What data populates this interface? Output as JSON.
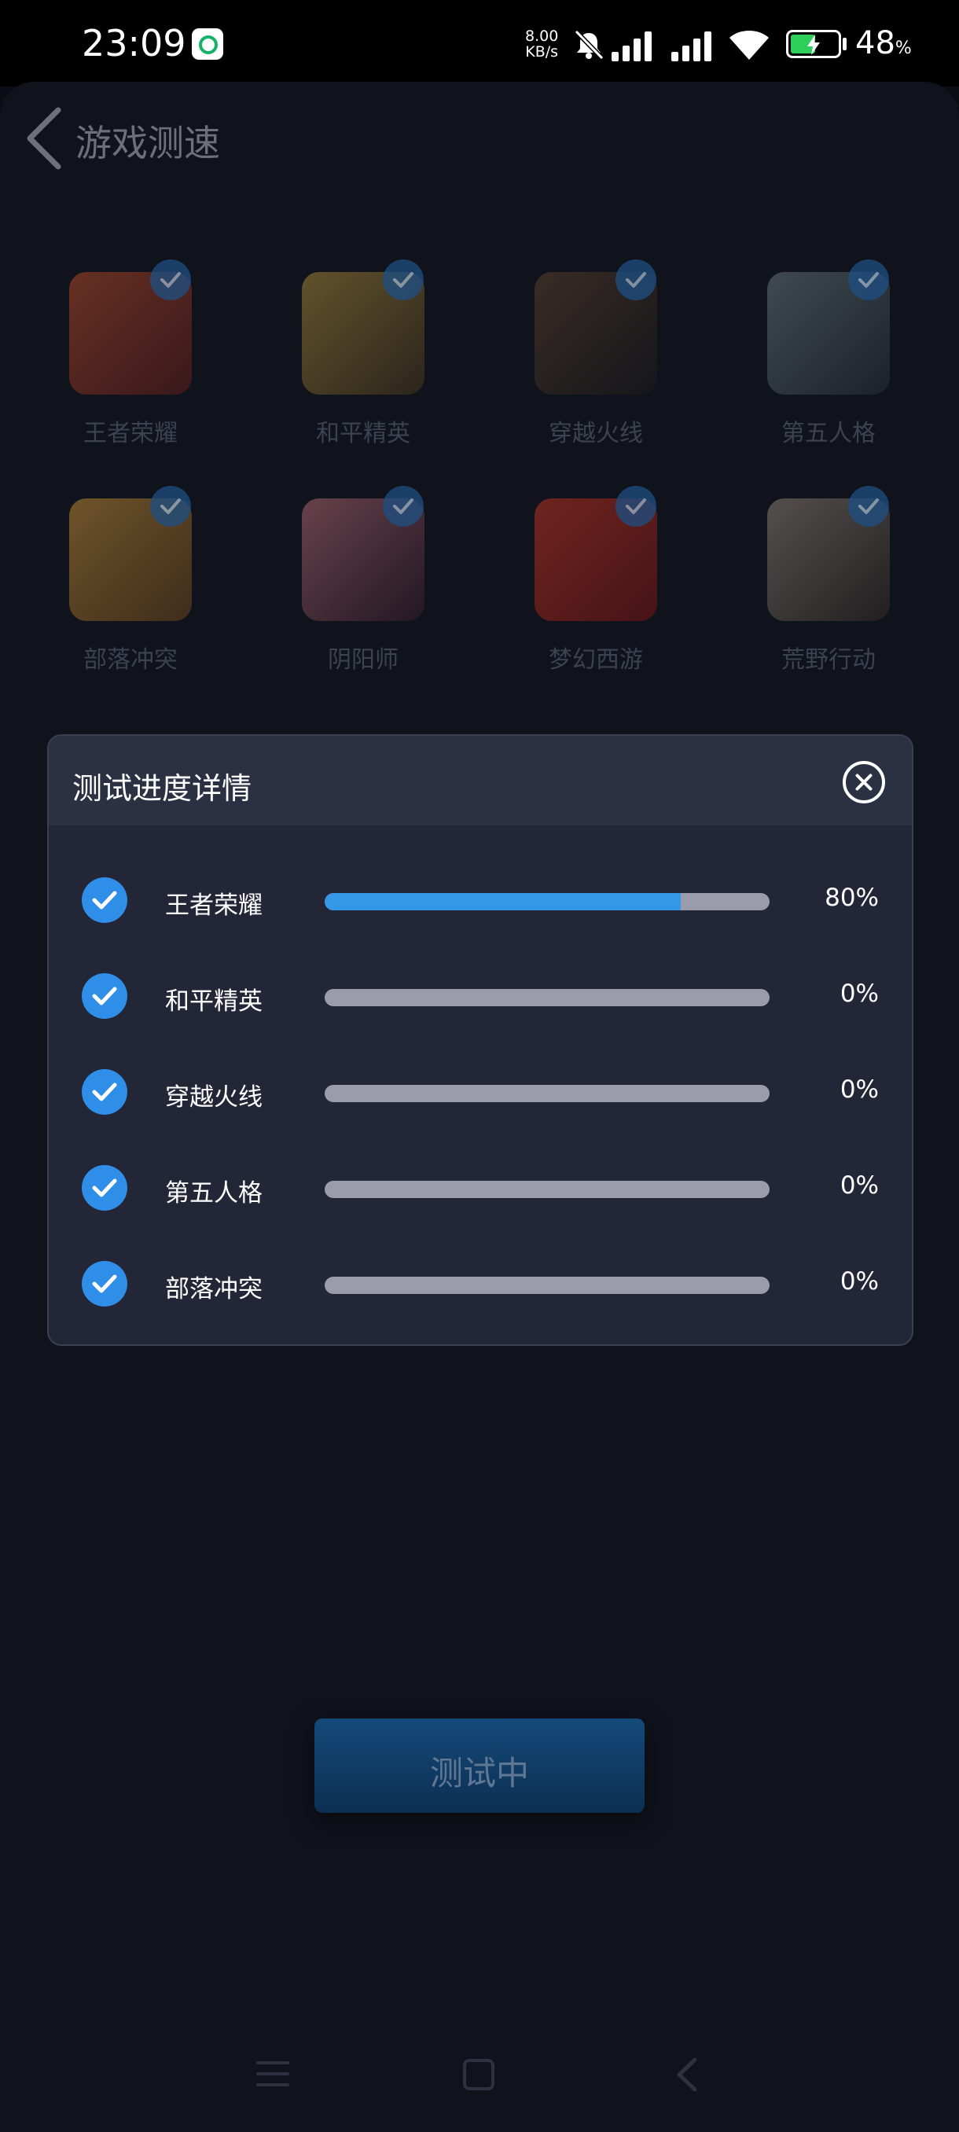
{
  "status_bar": {
    "time": "23:09",
    "net_speed_value": "8.00",
    "net_speed_unit": "KB/s",
    "battery_percent": "48",
    "battery_percent_sign": "%",
    "icons": [
      "app-notification-icon",
      "mute-icon",
      "signal-icon",
      "signal-icon",
      "wifi-icon",
      "battery-icon"
    ]
  },
  "header": {
    "title": "游戏测速",
    "back_icon": "chevron-left-icon"
  },
  "games": [
    {
      "name": "王者荣耀",
      "checked": true,
      "color": "#b8432f"
    },
    {
      "name": "和平精英",
      "checked": true,
      "color": "#9b7a2a"
    },
    {
      "name": "穿越火线",
      "checked": true,
      "color": "#4a3c34"
    },
    {
      "name": "第五人格",
      "checked": true,
      "color": "#5a6a72"
    },
    {
      "name": "部落冲突",
      "checked": true,
      "color": "#b8862a"
    },
    {
      "name": "阴阳师",
      "checked": true,
      "color": "#a0504e"
    },
    {
      "name": "梦幻西游",
      "checked": true,
      "color": "#b02418"
    },
    {
      "name": "荒野行动",
      "checked": true,
      "color": "#7a6e60"
    }
  ],
  "dialog": {
    "title": "测试进度详情",
    "close_icon": "close-circle-icon",
    "rows": [
      {
        "name": "王者荣耀",
        "percent_label": "80%",
        "progress": 0.8
      },
      {
        "name": "和平精英",
        "percent_label": "0%",
        "progress": 0
      },
      {
        "name": "穿越火线",
        "percent_label": "0%",
        "progress": 0
      },
      {
        "name": "第五人格",
        "percent_label": "0%",
        "progress": 0
      },
      {
        "name": "部落冲突",
        "percent_label": "0%",
        "progress": 0
      }
    ]
  },
  "test_button": {
    "label": "测试中"
  },
  "nav_bar": {
    "icons": [
      "menu-icon",
      "home-icon",
      "back-icon"
    ]
  },
  "colors": {
    "accent": "#3597e8",
    "check": "#2f8ee8",
    "background": "#10131c",
    "dialog": "#232636"
  }
}
